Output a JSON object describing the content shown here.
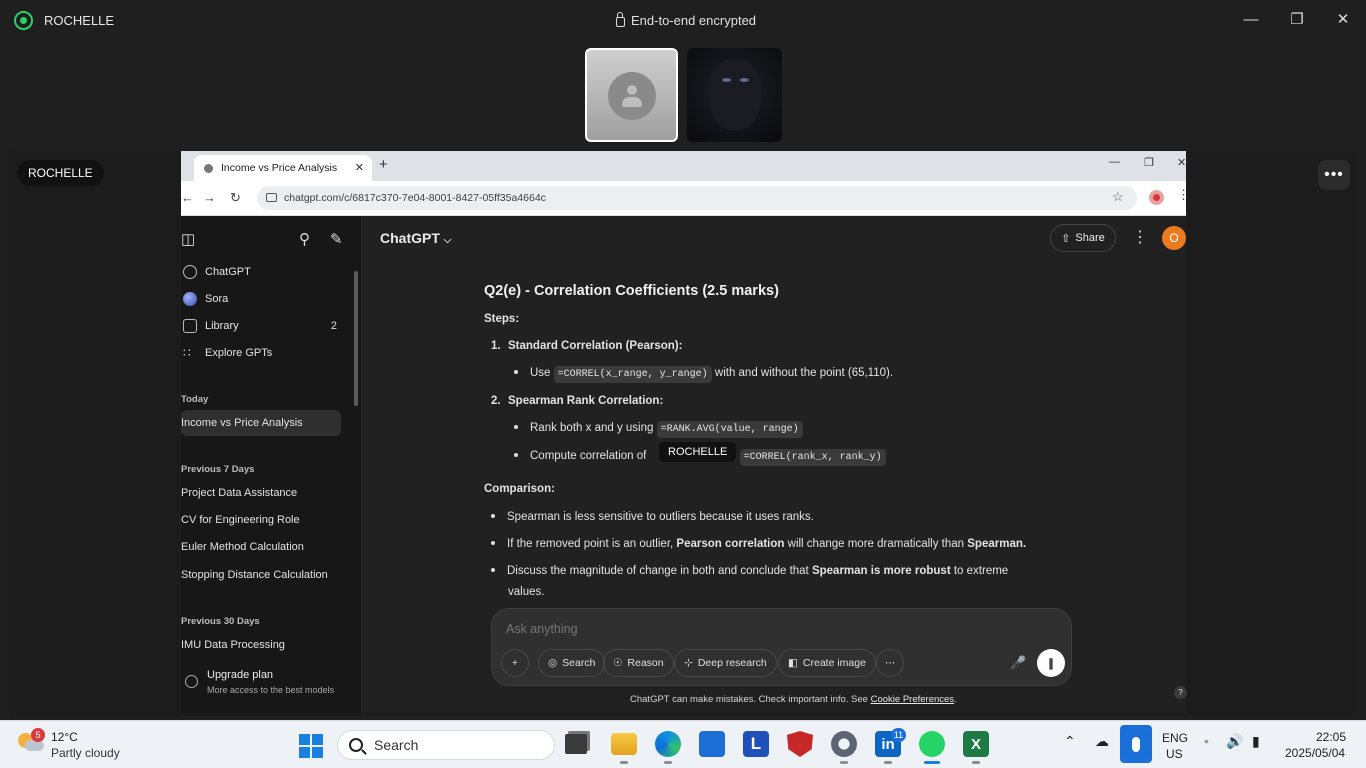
{
  "whatsapp": {
    "contact_name": "ROCHELLE",
    "encryption": "End-to-end encrypted",
    "share_badge": "ROCHELLE"
  },
  "browser": {
    "tab_title": "Income vs Price Analysis",
    "url": "chatgpt.com/c/6817c370-7e04-8001-8427-05ff35a4664c"
  },
  "chatgpt": {
    "model": "ChatGPT",
    "share_label": "Share",
    "user_initial": "O",
    "sidebar": {
      "nav": [
        {
          "label": "ChatGPT",
          "icon": "chatgpt-logo-icon"
        },
        {
          "label": "Sora",
          "icon": "sora-icon"
        },
        {
          "label": "Library",
          "icon": "library-icon",
          "count": "2"
        },
        {
          "label": "Explore GPTs",
          "icon": "grid-icon"
        }
      ],
      "today_label": "Today",
      "today": [
        "Income vs Price Analysis"
      ],
      "prev7_label": "Previous 7 Days",
      "prev7": [
        "Project Data Assistance",
        "CV for Engineering Role",
        "Euler Method Calculation",
        "Stopping Distance Calculation"
      ],
      "prev30_label": "Previous 30 Days",
      "prev30": [
        "IMU Data Processing"
      ],
      "upgrade_title": "Upgrade plan",
      "upgrade_sub": "More access to the best models"
    },
    "message": {
      "heading": "Q2(e) - Correlation Coefficients (2.5 marks)",
      "steps_label": "Steps:",
      "step1_num": "1.",
      "step1_title": "Standard Correlation (Pearson):",
      "step1_b1_pre": "Use",
      "step1_b1_code": "=CORREL(x_range, y_range)",
      "step1_b1_post": "with and without the point (65,110).",
      "step2_num": "2.",
      "step2_title": "Spearman Rank Correlation:",
      "step2_b1_pre": "Rank both x and y using",
      "step2_b1_code": "=RANK.AVG(value, range)",
      "step2_b2_pre": "Compute correlation of",
      "step2_b2_mid": "g",
      "step2_b2_code": "=CORREL(rank_x, rank_y)",
      "comparison_label": "Comparison:",
      "c1": "Spearman is less sensitive to outliers because it uses ranks.",
      "c2_pre": "If the removed point is an outlier,",
      "c2_b1": "Pearson correlation",
      "c2_mid": "will change more dramatically than",
      "c2_b2": "Spearman.",
      "c3_pre": "Discuss the magnitude of change in both and conclude that",
      "c3_b": "Spearman is more robust",
      "c3_post": "to extreme",
      "c3_cont": "values."
    },
    "tooltip": "ROCHELLE",
    "composer": {
      "placeholder": "Ask anything",
      "buttons": [
        "Search",
        "Reason",
        "Deep research",
        "Create image"
      ]
    },
    "disclaimer_pre": "ChatGPT can make mistakes. Check important info. See",
    "disclaimer_link": "Cookie Preferences",
    "disclaimer_post": "."
  },
  "taskbar": {
    "weather_badge": "5",
    "temperature": "12°C",
    "weather": "Partly cloudy",
    "search_placeholder": "Search",
    "linkedin_badge": "11",
    "lang_top": "ENG",
    "lang_bottom": "US",
    "time": "22:05",
    "date": "2025/05/04"
  }
}
